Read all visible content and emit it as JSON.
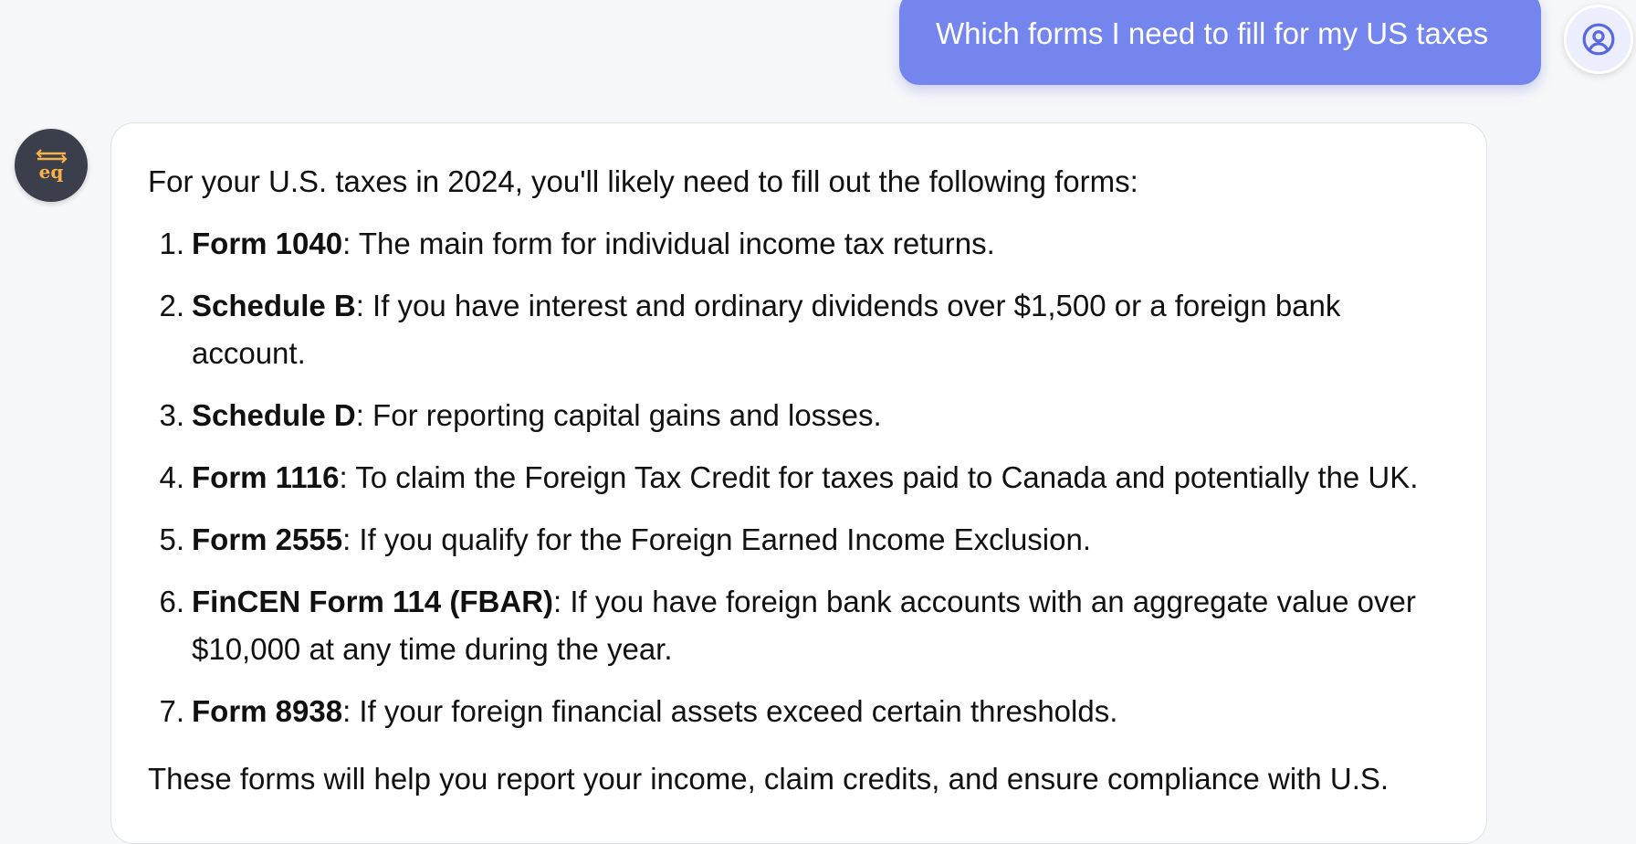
{
  "user_message": {
    "text": "Which forms I need to fill for my US taxes"
  },
  "user_avatar": {
    "icon": "user-circle-icon",
    "accent_color": "#5867e3"
  },
  "assistant_avatar": {
    "icon": "eq-logo-icon",
    "logo_text": "eq",
    "logo_color": "#f6b14a"
  },
  "assistant_message": {
    "intro": "For your U.S. taxes in 2024, you'll likely need to fill out the following forms:",
    "forms": [
      {
        "num": "1.",
        "name": "Form 1040",
        "description": ": The main form for individual income tax returns."
      },
      {
        "num": "2.",
        "name": "Schedule B",
        "description": ": If you have interest and ordinary dividends over $1,500 or a foreign bank account."
      },
      {
        "num": "3.",
        "name": "Schedule D",
        "description": ": For reporting capital gains and losses."
      },
      {
        "num": "4.",
        "name": "Form 1116",
        "description": ": To claim the Foreign Tax Credit for taxes paid to Canada and potentially the UK."
      },
      {
        "num": "5.",
        "name": "Form 2555",
        "description": ": If you qualify for the Foreign Earned Income Exclusion."
      },
      {
        "num": "6.",
        "name": "FinCEN Form 114 (FBAR)",
        "description": ": If you have foreign bank accounts with an aggregate value over $10,000 at any time during the year."
      },
      {
        "num": "7.",
        "name": "Form 8938",
        "description": ": If your foreign financial assets exceed certain thresholds."
      }
    ],
    "closing": "These forms will help you report your income, claim credits, and ensure compliance with U.S."
  },
  "colors": {
    "background": "#f6f7f9",
    "user_bubble": "#7585ee",
    "card": "#ffffff",
    "avatar_dark": "#3a3f4b"
  }
}
